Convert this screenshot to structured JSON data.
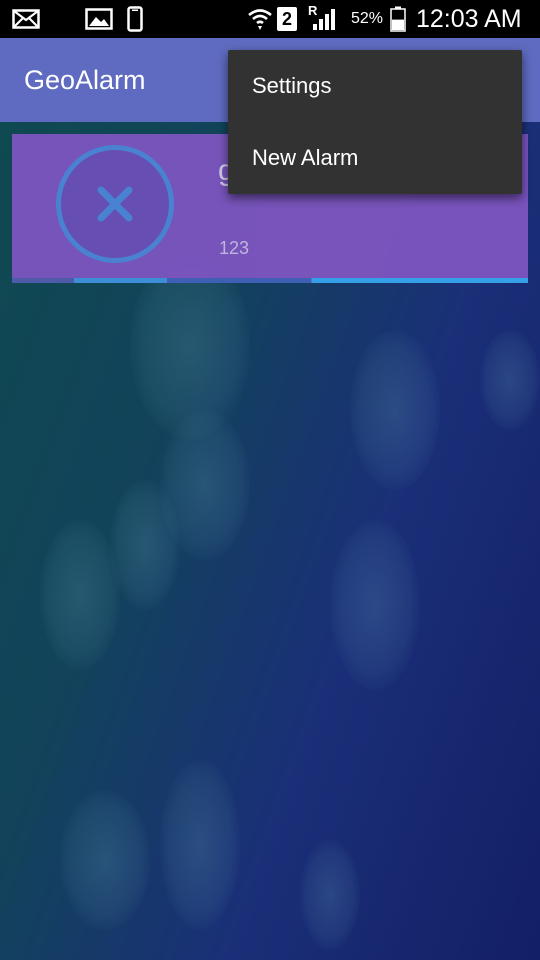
{
  "status_bar": {
    "icons": [
      "mail-icon",
      "image-icon",
      "phone-icon",
      "wifi-icon",
      "sim-icon",
      "signal-icon",
      "battery-icon"
    ],
    "sim_slot": "2",
    "roaming": "R",
    "battery_percent": "52%",
    "battery_level": 0.52,
    "time": "12:03 AM"
  },
  "app_bar": {
    "title": "GeoAlarm",
    "color": "#5e6bc0"
  },
  "alarm": {
    "name": "g",
    "subtitle": "123",
    "card_color": "#7d55c0",
    "delete_icon": "close-icon"
  },
  "menu": {
    "items": [
      {
        "label": "Settings"
      },
      {
        "label": "New Alarm"
      }
    ]
  }
}
